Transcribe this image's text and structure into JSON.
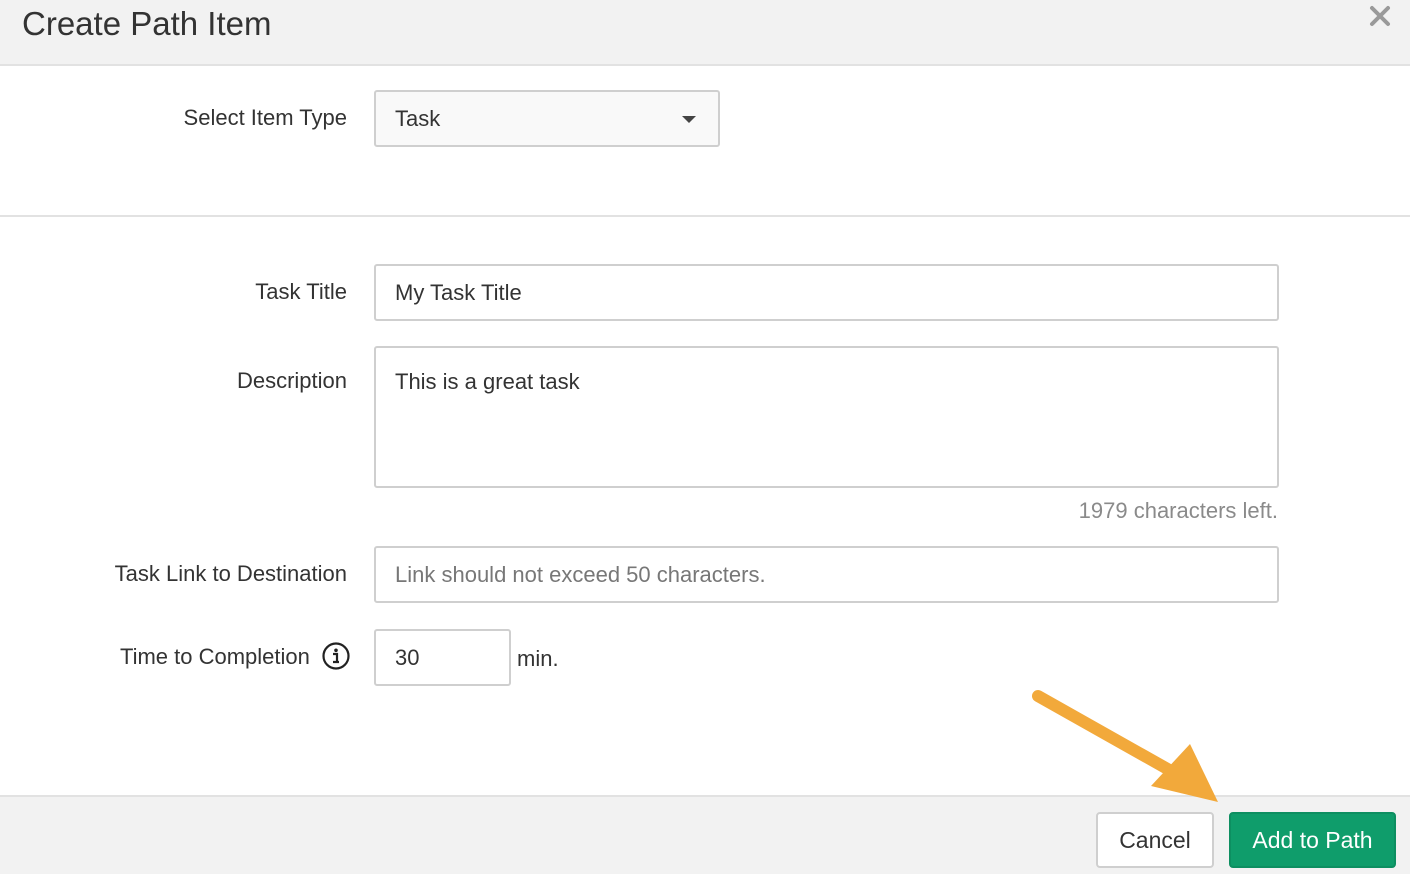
{
  "dialog": {
    "title": "Create Path Item"
  },
  "form": {
    "item_type": {
      "label": "Select Item Type",
      "value": "Task"
    },
    "task_title": {
      "label": "Task Title",
      "value": "My Task Title"
    },
    "description": {
      "label": "Description",
      "value": "This is a great task",
      "counter": "1979 characters left."
    },
    "link": {
      "label": "Task Link to Destination",
      "placeholder": "Link should not exceed 50 characters."
    },
    "time": {
      "label": "Time to Completion",
      "value": "30",
      "unit": "min."
    }
  },
  "footer": {
    "cancel_label": "Cancel",
    "submit_label": "Add to Path"
  },
  "icons": {
    "close": "close-icon",
    "info": "info-icon",
    "dropdown": "chevron-down-icon",
    "annotation": "arrow-annotation-icon"
  },
  "colors": {
    "primary_button": "#0f9d6b",
    "annotation_arrow": "#f2a93b",
    "header_bg": "#f2f2f2"
  }
}
